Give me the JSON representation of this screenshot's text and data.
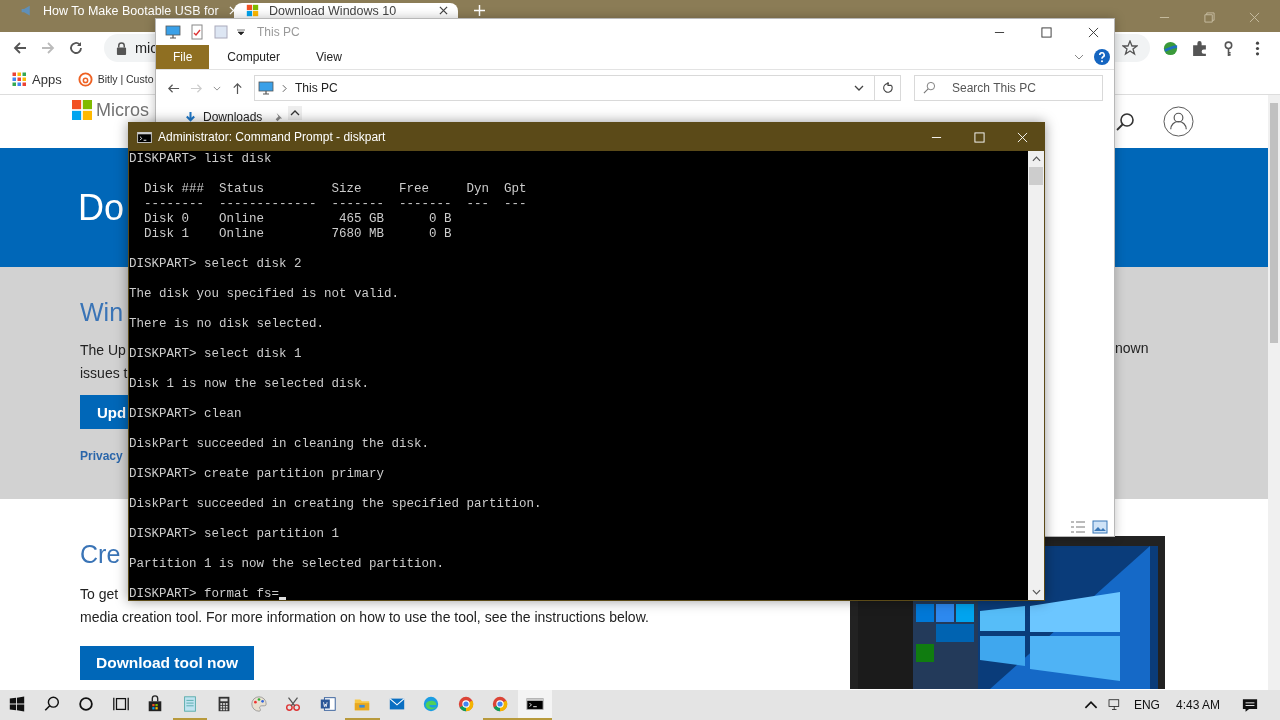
{
  "browser": {
    "tabs": [
      {
        "title": "How To Make Bootable USB for",
        "selected": false
      },
      {
        "title": "Download Windows 10",
        "selected": true
      }
    ],
    "address": "mic",
    "bookmarks": [
      {
        "label": "Apps",
        "kind": "apps"
      },
      {
        "label": "Bitly | Custo",
        "kind": "bitly"
      }
    ],
    "page": {
      "logo_text": "Micros",
      "banner_title": "Do",
      "section_title": "Win",
      "section_lines": [
        "The Up",
        "issues t"
      ],
      "section_right": "nown",
      "update_button": "Upd",
      "privacy_link": "Privacy",
      "create_title": "Cre",
      "create_lines": [
        "To get",
        "media creation tool. For more information on how to use the tool, see the instructions below."
      ],
      "download_button": "Download tool now",
      "image": {
        "kind": "picture"
      }
    }
  },
  "explorer": {
    "title": "This PC",
    "ribbon_tabs": [
      {
        "label": "File",
        "selected": true
      },
      {
        "label": "Computer",
        "selected": false
      },
      {
        "label": "View",
        "selected": false
      }
    ],
    "address": "This PC",
    "search": {
      "placeholder": "Search This PC"
    },
    "nav_items": [
      {
        "label": "Downloads",
        "pinned": true
      }
    ]
  },
  "cmd": {
    "title": "Administrator: Command Prompt - diskpart",
    "cursor": true,
    "blocks": [
      [
        "DISKPART> list disk"
      ],
      [
        "  Disk ###  Status         Size     Free     Dyn  Gpt",
        "  --------  -------------  -------  -------  ---  ---",
        "  Disk 0    Online          465 GB      0 B",
        "  Disk 1    Online         7680 MB      0 B"
      ],
      [
        "DISKPART> select disk 2"
      ],
      [
        "The disk you specified is not valid."
      ],
      [
        "There is no disk selected."
      ],
      [
        "DISKPART> select disk 1"
      ],
      [
        "Disk 1 is now the selected disk."
      ],
      [
        "DISKPART> clean"
      ],
      [
        "DiskPart succeeded in cleaning the disk."
      ],
      [
        "DISKPART> create partition primary"
      ],
      [
        "DiskPart succeeded in creating the specified partition."
      ],
      [
        "DISKPART> select partition 1"
      ],
      [
        "Partition 1 is now the selected partition."
      ],
      [
        "DISKPART> format fs="
      ]
    ]
  },
  "taskbar": {
    "items": [
      {
        "kind": "start",
        "running": false,
        "active": false
      },
      {
        "kind": "search",
        "running": false,
        "active": false
      },
      {
        "kind": "cortana",
        "running": false,
        "active": false
      },
      {
        "kind": "taskview",
        "running": false,
        "active": false
      },
      {
        "kind": "store",
        "running": false,
        "active": false
      },
      {
        "kind": "notepad",
        "running": true,
        "active": false
      },
      {
        "kind": "calculator",
        "running": false,
        "active": false
      },
      {
        "kind": "paint",
        "running": false,
        "active": false
      },
      {
        "kind": "snip",
        "running": false,
        "active": false
      },
      {
        "kind": "word",
        "running": false,
        "active": false
      },
      {
        "kind": "explorer",
        "running": true,
        "active": false
      },
      {
        "kind": "mail",
        "running": false,
        "active": false
      },
      {
        "kind": "edge",
        "running": false,
        "active": false
      },
      {
        "kind": "chrome",
        "running": false,
        "active": false
      },
      {
        "kind": "chrome",
        "running": true,
        "active": false
      },
      {
        "kind": "cmd",
        "running": true,
        "active": true
      }
    ],
    "language": "ENG",
    "time": "4:43 AM"
  }
}
